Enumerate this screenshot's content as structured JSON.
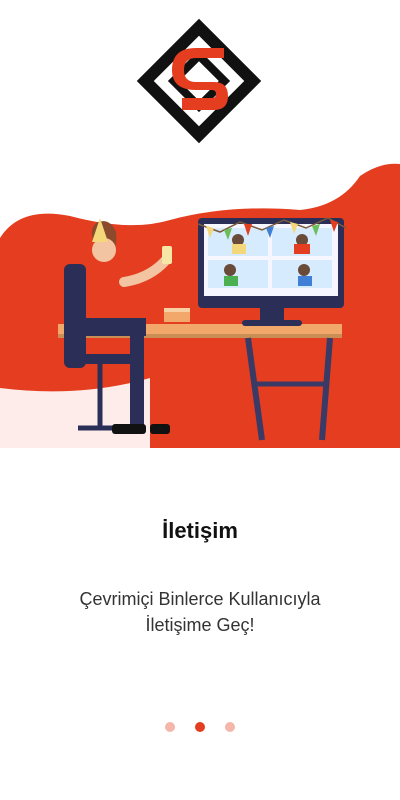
{
  "onboarding": {
    "title": "İletişim",
    "subtitle_line1": "Çevrimiçi Binlerce Kullanıcıyla",
    "subtitle_line2": "İletişime Geç!",
    "pages_total": 3,
    "active_page": 2
  },
  "colors": {
    "accent": "#e43d1f",
    "dot_inactive": "#f4b7a9",
    "logo_dark": "#111111"
  },
  "icons": {
    "logo": "s-diamond-logo",
    "illustration": "video-call-party-illustration"
  }
}
